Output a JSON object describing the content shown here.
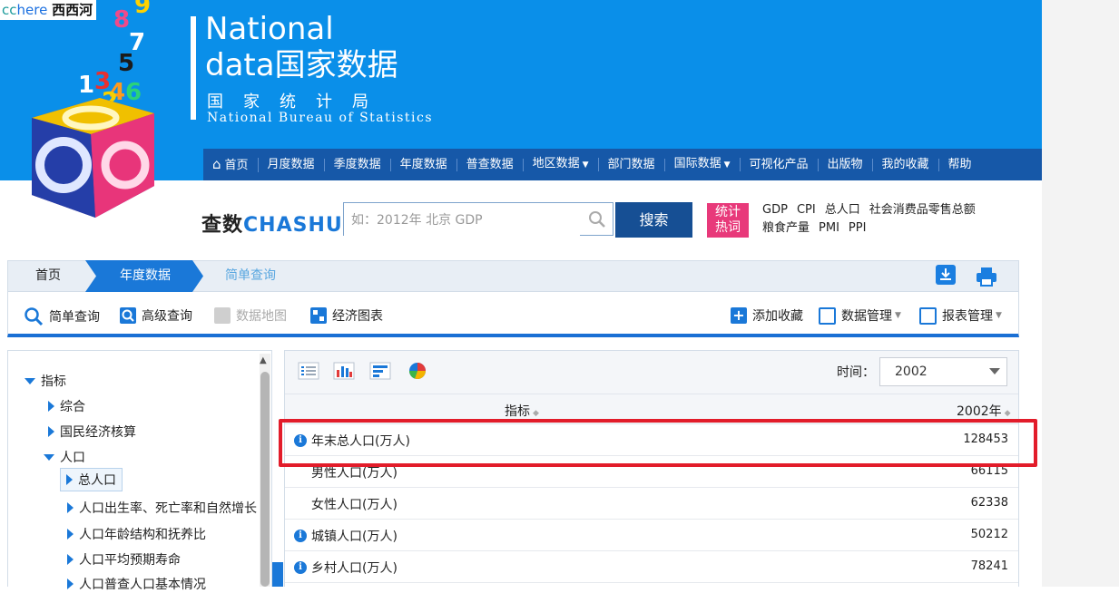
{
  "watermark": {
    "part1": "cc",
    "part2": "here",
    "part3": "西西河"
  },
  "logo": {
    "line1": "National",
    "line2": "data国家数据",
    "cn": "国家统计局",
    "en": "National Bureau of Statistics"
  },
  "nav": [
    {
      "label": "首页"
    },
    {
      "label": "月度数据"
    },
    {
      "label": "季度数据"
    },
    {
      "label": "年度数据"
    },
    {
      "label": "普查数据"
    },
    {
      "label": "地区数据"
    },
    {
      "label": "部门数据"
    },
    {
      "label": "国际数据"
    },
    {
      "label": "可视化产品"
    },
    {
      "label": "出版物"
    },
    {
      "label": "我的收藏"
    },
    {
      "label": "帮助"
    }
  ],
  "search": {
    "brand_cn": "查数",
    "brand_en": "CHASHU",
    "placeholder": "如：2012年 北京 GDP",
    "button": "搜索"
  },
  "hot": {
    "badge_line1": "统计",
    "badge_line2": "热词",
    "terms": [
      "GDP",
      "CPI",
      "总人口",
      "社会消费品零售总额",
      "粮食产量",
      "PMI",
      "PPI"
    ]
  },
  "breadcrumb": {
    "home": "首页",
    "year": "年度数据",
    "current": "简单查询"
  },
  "toolbar": {
    "simple": "简单查询",
    "advanced": "高级查询",
    "map": "数据地图",
    "chart": "经济图表",
    "fav": "添加收藏",
    "data_mgmt": "数据管理",
    "report_mgmt": "报表管理"
  },
  "tree": {
    "root": "指标",
    "items": [
      "综合",
      "国民经济核算",
      "人口"
    ],
    "children": [
      "总人口",
      "人口出生率、死亡率和自然增长",
      "人口年龄结构和抚养比",
      "人口平均预期寿命",
      "人口普查人口基本情况"
    ]
  },
  "panel": {
    "time_label": "时间：",
    "time_value": "2002",
    "col_indicator": "指标",
    "col_year": "2002年"
  },
  "rows": [
    {
      "name": "年末总人口(万人)",
      "value": "128453"
    },
    {
      "name": "男性人口(万人)",
      "value": "66115"
    },
    {
      "name": "女性人口(万人)",
      "value": "62338"
    },
    {
      "name": "城镇人口(万人)",
      "value": "50212"
    },
    {
      "name": "乡村人口(万人)",
      "value": "78241"
    }
  ],
  "colors": {
    "header_blue": "#0a8fe9",
    "nav_blue": "#1658a8",
    "accent": "#1a78d8",
    "highlight": "#e21c2a",
    "hot_pink": "#e8397a"
  }
}
